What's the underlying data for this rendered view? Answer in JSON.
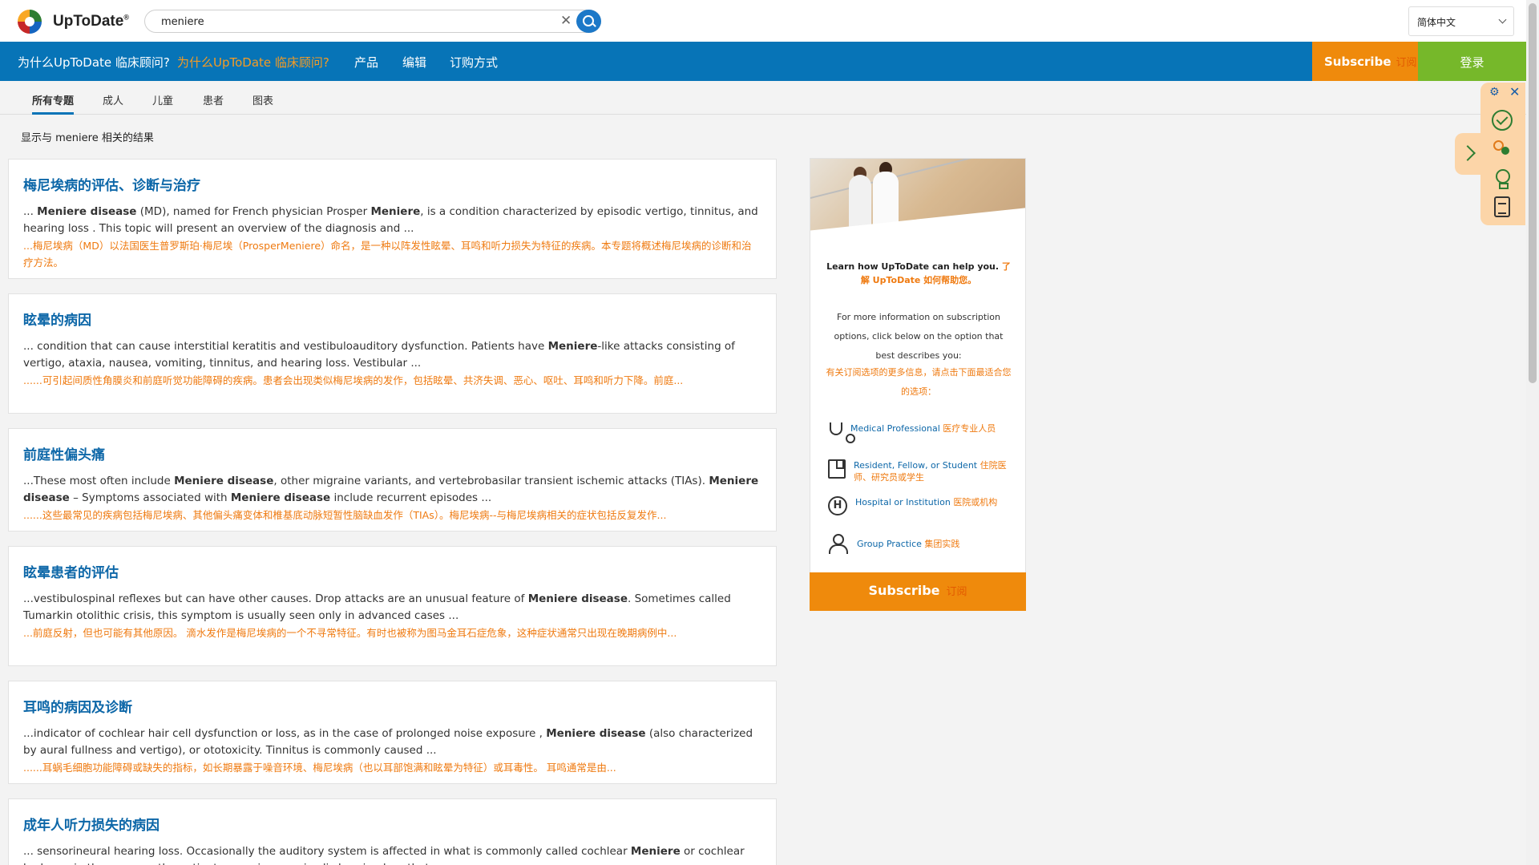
{
  "header": {
    "logo_text": "UpToDate",
    "logo_reg": "®",
    "search_value": "meniere",
    "language": "简体中文"
  },
  "nav": {
    "why_en": "为什么UpToDate 临床顾问?",
    "why_cn": "为什么UpToDate 临床顾问?",
    "products": "产品",
    "editorial": "编辑",
    "purchase": "订购方式",
    "subscribe": "Subscribe",
    "subscribe_cn": "订阅",
    "login": "登录"
  },
  "tabs": [
    "所有专题",
    "成人",
    "儿童",
    "患者",
    "图表"
  ],
  "results_heading": "显示与 meniere 相关的结果",
  "results": [
    {
      "title": "梅尼埃病的评估、诊断与治疗",
      "en_prefix": "... ",
      "en_parts": [
        {
          "t": "Meniere disease",
          "b": true
        },
        {
          "t": " (MD), named for French physician Prosper ",
          "b": false
        },
        {
          "t": "Meniere",
          "b": true
        },
        {
          "t": ", is a condition characterized by episodic vertigo, tinnitus, and hearing loss . This topic will present an overview of the diagnosis and ...",
          "b": false
        }
      ],
      "cn": "...梅尼埃病（MD）以法国医生普罗斯珀·梅尼埃（ProsperMeniere）命名，是一种以阵发性眩晕、耳鸣和听力损失为特征的疾病。本专题将概述梅尼埃病的诊断和治疗方法。"
    },
    {
      "title": "眩晕的病因",
      "en_prefix": "... ",
      "en_parts": [
        {
          "t": "condition that can cause interstitial keratitis and vestibuloauditory dysfunction. Patients have ",
          "b": false
        },
        {
          "t": "Meniere",
          "b": true
        },
        {
          "t": "-like attacks consisting of vertigo, ataxia, nausea, vomiting, tinnitus, and hearing loss. Vestibular ...",
          "b": false
        }
      ],
      "cn": "......可引起间质性角膜炎和前庭听觉功能障碍的疾病。患者会出现类似梅尼埃病的发作，包括眩晕、共济失调、恶心、呕吐、耳鸣和听力下降。前庭..."
    },
    {
      "title": "前庭性偏头痛",
      "en_prefix": "...",
      "en_parts": [
        {
          "t": "These most often include ",
          "b": false
        },
        {
          "t": "Meniere disease",
          "b": true
        },
        {
          "t": ", other migraine variants, and vertebrobasilar transient ischemic attacks (TIAs). ",
          "b": false
        },
        {
          "t": "Meniere disease",
          "b": true
        },
        {
          "t": " – Symptoms associated with ",
          "b": false
        },
        {
          "t": "Meniere disease",
          "b": true
        },
        {
          "t": " include recurrent episodes ...",
          "b": false
        }
      ],
      "cn": "......这些最常见的疾病包括梅尼埃病、其他偏头痛变体和椎基底动脉短暂性脑缺血发作（TIAs）。梅尼埃病--与梅尼埃病相关的症状包括反复发作..."
    },
    {
      "title": "眩晕患者的评估",
      "en_prefix": "...",
      "en_parts": [
        {
          "t": "vestibulospinal reflexes but can have other causes. Drop attacks are an unusual feature of ",
          "b": false
        },
        {
          "t": "Meniere disease",
          "b": true
        },
        {
          "t": ". Sometimes called Tumarkin otolithic crisis, this symptom is usually seen only in advanced cases ...",
          "b": false
        }
      ],
      "cn": "...前庭反射，但也可能有其他原因。 滴水发作是梅尼埃病的一个不寻常特征。有时也被称为图马金耳石症危象，这种症状通常只出现在晚期病例中..."
    },
    {
      "title": "耳鸣的病因及诊断",
      "en_prefix": "...",
      "en_parts": [
        {
          "t": "indicator of cochlear hair cell dysfunction or loss, as in the case of prolonged noise exposure , ",
          "b": false
        },
        {
          "t": "Meniere disease",
          "b": true
        },
        {
          "t": " (also characterized by aural fullness and vertigo), or ototoxicity. Tinnitus is commonly caused ...",
          "b": false
        }
      ],
      "cn": "......耳蜗毛细胞功能障碍或缺失的指标，如长期暴露于噪音环境、梅尼埃病（也以耳部饱满和眩晕为特征）或耳毒性。 耳鸣通常是由..."
    },
    {
      "title": "成年人听力损失的病因",
      "en_prefix": "... ",
      "en_parts": [
        {
          "t": "sensorineural hearing loss. Occasionally the auditory system is affected in what is commonly called cochlear ",
          "b": false
        },
        {
          "t": "Meniere",
          "b": true
        },
        {
          "t": " or cochlear hydrops; in these cases, the patients experience episodic hearing loss that recovers ...",
          "b": false
        }
      ],
      "cn": ""
    }
  ],
  "promo": {
    "learn_en": "Learn how UpToDate can help you.",
    "learn_cn": "了解 UpToDate 如何帮助您。",
    "info_en": "For more information on subscription options, click below on the option that best describes you:",
    "info_cn": "有关订阅选项的更多信息，请点击下面最适合您的选项：",
    "options": [
      {
        "en": "Medical Professional",
        "cn": "医疗专业人员",
        "icon": "stethoscope-icon"
      },
      {
        "en": "Resident, Fellow, or Student",
        "cn": "住院医师、研究员或学生",
        "icon": "book-icon"
      },
      {
        "en": "Hospital or Institution",
        "cn": "医院或机构",
        "icon": "hospital-icon"
      },
      {
        "en": "Group Practice",
        "cn": "集团实践",
        "icon": "group-icon"
      }
    ],
    "subscribe": "Subscribe",
    "subscribe_cn": "订阅"
  },
  "colors": {
    "nav_blue": "#0774b7",
    "subscribe_orange": "#ef8a0c",
    "login_green": "#76b82a",
    "link_blue": "#0d67a8",
    "translation_orange": "#ef7a10"
  }
}
